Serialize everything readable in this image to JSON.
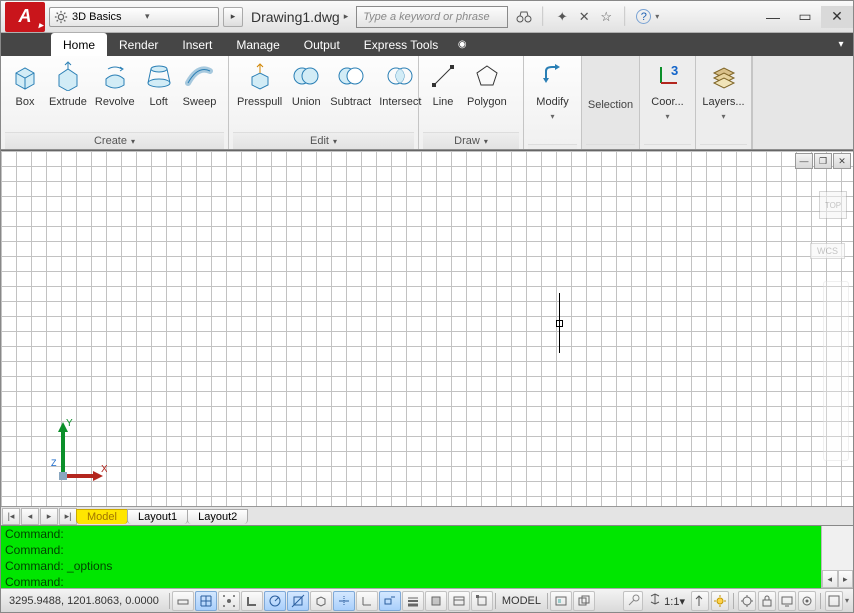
{
  "titlebar": {
    "app_initial": "A",
    "workspace": "3D Basics",
    "doc_title": "Drawing1.dwg",
    "search_placeholder": "Type a keyword or phrase"
  },
  "tabs": {
    "items": [
      "Home",
      "Render",
      "Insert",
      "Manage",
      "Output",
      "Express Tools"
    ],
    "active": 0
  },
  "ribbon": {
    "create": {
      "title": "Create",
      "box": "Box",
      "extrude": "Extrude",
      "revolve": "Revolve",
      "loft": "Loft",
      "sweep": "Sweep"
    },
    "edit": {
      "title": "Edit",
      "presspull": "Presspull",
      "union": "Union",
      "subtract": "Subtract",
      "intersect": "Intersect"
    },
    "draw": {
      "title": "Draw",
      "line": "Line",
      "polygon": "Polygon"
    },
    "modify": {
      "title": "Modify",
      "label": "Modify"
    },
    "selection": {
      "title": "Selection",
      "label": "Selection"
    },
    "coord": {
      "title": "Coor...",
      "label": "Coor...",
      "num": "3"
    },
    "layers": {
      "title": "Layers...",
      "label": "Layers..."
    }
  },
  "nav": {
    "wcs": "WCS",
    "top": "TOP"
  },
  "layout": {
    "model": "Model",
    "l1": "Layout1",
    "l2": "Layout2"
  },
  "cmd": {
    "l1": "Command:",
    "l2": "Command:",
    "l3": "Command: _options",
    "l4": "Command:"
  },
  "status": {
    "coords": "3295.9488, 1201.8063, 0.0000",
    "model": "MODEL",
    "scale": "1:1"
  }
}
